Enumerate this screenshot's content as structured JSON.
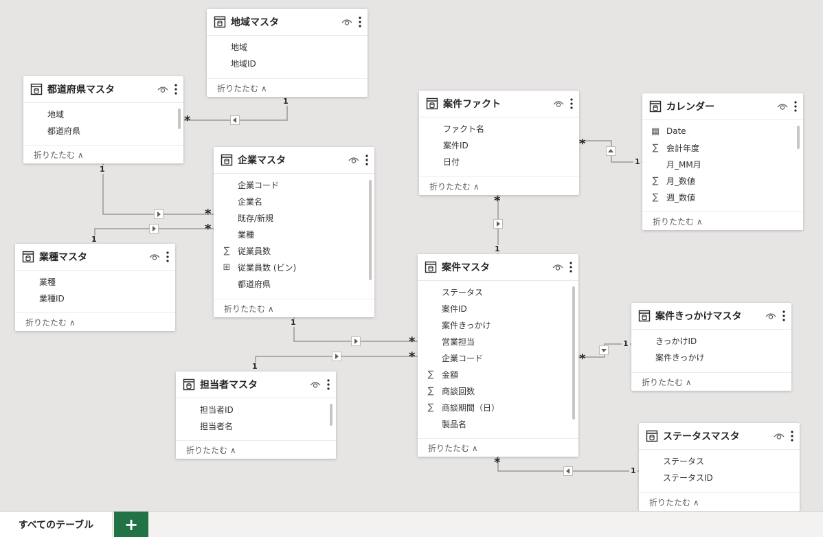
{
  "tables": [
    {
      "key": "chiiki",
      "title": "地域マスタ",
      "collapse_label": "折りたたむ ∧",
      "fields": [
        {
          "icon": "none",
          "label": "地域"
        },
        {
          "icon": "none",
          "label": "地域ID"
        }
      ]
    },
    {
      "key": "todofuken",
      "title": "都道府県マスタ",
      "collapse_label": "折りたたむ ∧",
      "fields": [
        {
          "icon": "none",
          "label": "地域"
        },
        {
          "icon": "none",
          "label": "都道府県"
        }
      ]
    },
    {
      "key": "kigyo",
      "title": "企業マスタ",
      "collapse_label": "折りたたむ ∧",
      "fields": [
        {
          "icon": "none",
          "label": "企業コード"
        },
        {
          "icon": "none",
          "label": "企業名"
        },
        {
          "icon": "none",
          "label": "既存/新規"
        },
        {
          "icon": "none",
          "label": "業種"
        },
        {
          "icon": "sigma",
          "label": "従業員数"
        },
        {
          "icon": "bin",
          "label": "従業員数 (ビン)"
        },
        {
          "icon": "none",
          "label": "都道府県"
        }
      ]
    },
    {
      "key": "gyoshu",
      "title": "業種マスタ",
      "collapse_label": "折りたたむ ∧",
      "fields": [
        {
          "icon": "none",
          "label": "業種"
        },
        {
          "icon": "none",
          "label": "業種ID"
        }
      ]
    },
    {
      "key": "anken_fact",
      "title": "案件ファクト",
      "collapse_label": "折りたたむ ∧",
      "fields": [
        {
          "icon": "none",
          "label": "ファクト名"
        },
        {
          "icon": "none",
          "label": "案件ID"
        },
        {
          "icon": "none",
          "label": "日付"
        }
      ]
    },
    {
      "key": "calendar",
      "title": "カレンダー",
      "collapse_label": "折りたたむ ∧",
      "fields": [
        {
          "icon": "calendar",
          "label": "Date"
        },
        {
          "icon": "sigma",
          "label": "会計年度"
        },
        {
          "icon": "none",
          "label": "月_MM月"
        },
        {
          "icon": "sigma",
          "label": "月_数値"
        },
        {
          "icon": "sigma",
          "label": "週_数値"
        }
      ]
    },
    {
      "key": "anken",
      "title": "案件マスタ",
      "collapse_label": "折りたたむ ∧",
      "fields": [
        {
          "icon": "none",
          "label": "ステータス"
        },
        {
          "icon": "none",
          "label": "案件ID"
        },
        {
          "icon": "none",
          "label": "案件きっかけ"
        },
        {
          "icon": "none",
          "label": "営業担当"
        },
        {
          "icon": "none",
          "label": "企業コード"
        },
        {
          "icon": "sigma",
          "label": "金額"
        },
        {
          "icon": "sigma",
          "label": "商談回数"
        },
        {
          "icon": "sigma",
          "label": "商談期間（日）"
        },
        {
          "icon": "none",
          "label": "製品名"
        }
      ]
    },
    {
      "key": "kikkake",
      "title": "案件きっかけマスタ",
      "collapse_label": "折りたたむ ∧",
      "fields": [
        {
          "icon": "none",
          "label": "きっかけID"
        },
        {
          "icon": "none",
          "label": "案件きっかけ"
        }
      ]
    },
    {
      "key": "tanto",
      "title": "担当者マスタ",
      "collapse_label": "折りたたむ ∧",
      "fields": [
        {
          "icon": "none",
          "label": "担当者ID"
        },
        {
          "icon": "none",
          "label": "担当者名"
        }
      ]
    },
    {
      "key": "status",
      "title": "ステータスマスタ",
      "collapse_label": "折りたたむ ∧",
      "fields": [
        {
          "icon": "none",
          "label": "ステータス"
        },
        {
          "icon": "none",
          "label": "ステータスID"
        }
      ]
    }
  ],
  "cardinality": {
    "one": "1",
    "many": "*"
  },
  "bottom_bar": {
    "tab_label": "すべてのテーブル",
    "add_label": "+"
  }
}
